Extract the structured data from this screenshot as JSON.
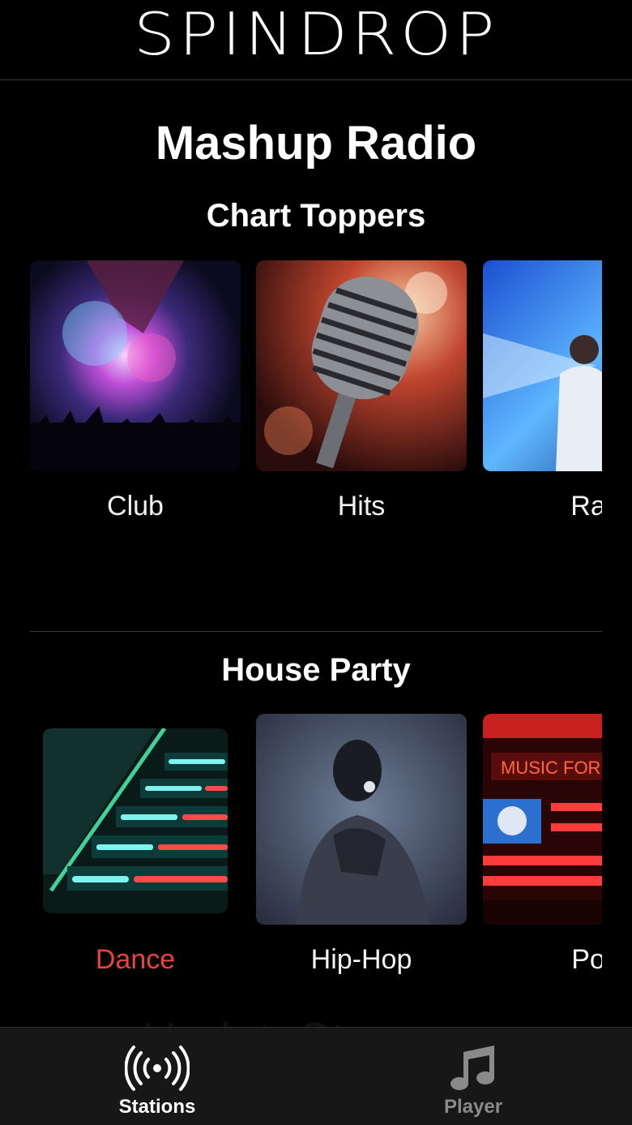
{
  "header": {
    "logo_text": "SPINDROP"
  },
  "page": {
    "title": "Mashup Radio"
  },
  "sections": [
    {
      "title": "Chart Toppers",
      "stations": [
        {
          "label": "Club",
          "image": "concert-crowd-confetti"
        },
        {
          "label": "Hits",
          "image": "vintage-microphone"
        },
        {
          "label": "Ra",
          "image": "rapper-on-stage-blue-light"
        }
      ]
    },
    {
      "title": "House Party",
      "stations": [
        {
          "label": "Dance",
          "image": "led-lit-staircase",
          "selected": true
        },
        {
          "label": "Hip-Hop",
          "image": "performer-with-microphone"
        },
        {
          "label": "Po",
          "image": "neon-bar-music-for-th"
        }
      ]
    }
  ],
  "tabs": [
    {
      "label": "Stations",
      "icon": "broadcast-icon",
      "active": true
    },
    {
      "label": "Player",
      "icon": "music-note-icon",
      "active": false
    }
  ],
  "watermark": "UpdateStar.com",
  "colors": {
    "background": "#000000",
    "accent": "#e8453a",
    "tab_bar": "#171717",
    "inactive_tab": "#8a8a8a"
  }
}
